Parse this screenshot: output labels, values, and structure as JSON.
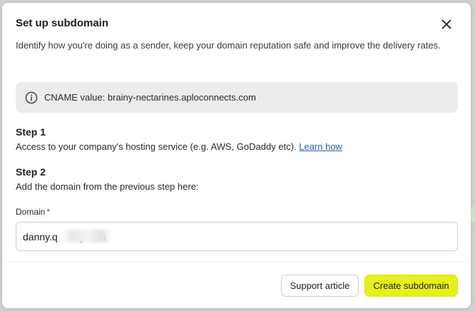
{
  "modal": {
    "title": "Set up subdomain",
    "description": "Identify how you're doing as a sender, keep your domain reputation safe and improve the delivery rates.",
    "info": {
      "icon": "info-icon",
      "text": "CNAME value: brainy-nectarines.aploconnects.com"
    },
    "step1": {
      "heading": "Step 1",
      "text": "Access to your company's hosting service (e.g. AWS, GoDaddy etc).",
      "link": "Learn how"
    },
    "step2": {
      "heading": "Step 2",
      "text": "Add the domain from the previous step here:"
    },
    "domain_field": {
      "label": "Domain",
      "required_mark": "*",
      "value": "danny.q        y.com"
    },
    "buttons": {
      "secondary": "Support article",
      "primary": "Create subdomain"
    },
    "colors": {
      "primary_button": "#e6f01c",
      "link": "#2b5ea8",
      "required": "#cc2a2a"
    }
  }
}
